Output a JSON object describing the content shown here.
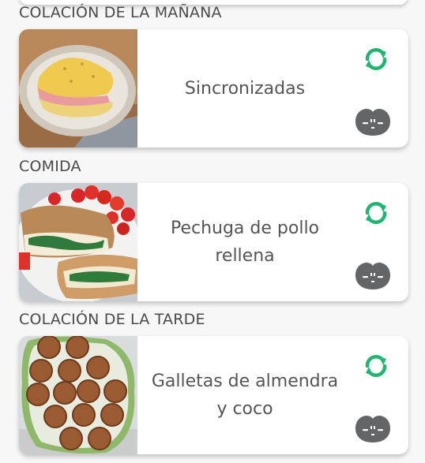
{
  "colors": {
    "accent": "#21b573",
    "mood_icon": "#646566",
    "section_text": "#4a4a4a",
    "card_text": "#555555"
  },
  "sections": [
    {
      "title": "COLACIÓN DE LA MAÑANA",
      "meal": {
        "name_lines": [
          "Sincronizadas"
        ],
        "photo": "quesadilla-photo"
      },
      "icons": [
        "refresh-icon",
        "mood-face-icon"
      ]
    },
    {
      "title": "COMIDA",
      "meal": {
        "name_lines": [
          "Pechuga de pollo",
          "rellena"
        ],
        "photo": "stuffed-chicken-photo"
      },
      "icons": [
        "refresh-icon",
        "mood-face-icon"
      ]
    },
    {
      "title": "COLACIÓN DE LA TARDE",
      "meal": {
        "name_lines": [
          "Galletas de almendra",
          "y coco"
        ],
        "photo": "almond-cookies-photo"
      },
      "icons": [
        "refresh-icon",
        "mood-face-icon"
      ]
    }
  ]
}
